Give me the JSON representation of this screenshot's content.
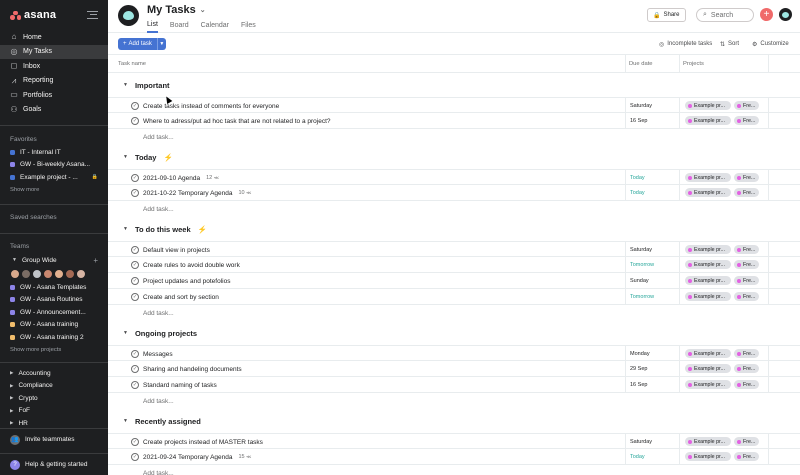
{
  "sidebar": {
    "logo_text": "asana",
    "nav": [
      {
        "label": "Home",
        "icon": "home-icon"
      },
      {
        "label": "My Tasks",
        "icon": "check-circle-icon",
        "active": true
      },
      {
        "label": "Inbox",
        "icon": "bell-icon"
      },
      {
        "label": "Reporting",
        "icon": "chart-line-icon"
      },
      {
        "label": "Portfolios",
        "icon": "folder-icon"
      },
      {
        "label": "Goals",
        "icon": "person-icon"
      }
    ],
    "favorites_heading": "Favorites",
    "favorites": [
      {
        "label": "IT - Internal IT",
        "color": "#4573d2"
      },
      {
        "label": "GW - Bi-weekly Asana...",
        "color": "#8d84e8"
      },
      {
        "label": "Example project - ...",
        "color": "#4573d2",
        "locked": true
      }
    ],
    "favorites_show_more": "Show more",
    "saved_searches_heading": "Saved searches",
    "teams_heading": "Teams",
    "team_name": "Group Wide",
    "team_projects": [
      {
        "label": "GW - Asana Templates",
        "color": "#8d84e8"
      },
      {
        "label": "GW - Asana Routines",
        "color": "#8d84e8"
      },
      {
        "label": "GW - Announcement...",
        "color": "#8d84e8"
      },
      {
        "label": "GW - Asana training",
        "color": "#f1bd6c"
      },
      {
        "label": "GW - Asana training 2",
        "color": "#f1bd6c"
      }
    ],
    "team_show_more": "Show more projects",
    "other_teams": [
      "Accounting",
      "Compliance",
      "Crypto",
      "FoF",
      "HR"
    ],
    "invite_label": "Invite teammates",
    "help_label": "Help & getting started"
  },
  "header": {
    "title": "My Tasks",
    "tabs": [
      "List",
      "Board",
      "Calendar",
      "Files"
    ],
    "share_label": "Share",
    "search_placeholder": "Search"
  },
  "toolbar": {
    "add_task_label": "Add task",
    "incomplete_label": "Incomplete tasks",
    "sort_label": "Sort",
    "customize_label": "Customize"
  },
  "table": {
    "columns": [
      "Task name",
      "Due date",
      "Projects"
    ],
    "add_task_text": "Add task...",
    "tag_project": "Example pr...",
    "tag_second": "Fre...",
    "sections": [
      {
        "name": "Important",
        "emoji": "",
        "tasks": [
          {
            "name": "Create tasks instead of comments for everyone",
            "due": "Saturday",
            "due_color": "normal",
            "sub": ""
          },
          {
            "name": "Where to adress/put ad hoc task that are not related to a project?",
            "due": "16 Sep",
            "due_color": "normal",
            "sub": ""
          }
        ]
      },
      {
        "name": "Today",
        "emoji": "⚡",
        "tasks": [
          {
            "name": "2021-09-10 Agenda",
            "due": "Today",
            "due_color": "green",
            "sub": "12 ⪻"
          },
          {
            "name": "2021-10-22 Temporary Agenda",
            "due": "Today",
            "due_color": "green",
            "sub": "10 ⪻"
          }
        ]
      },
      {
        "name": "To do this week",
        "emoji": "⚡",
        "tasks": [
          {
            "name": "Default view in projects",
            "due": "Saturday",
            "due_color": "normal",
            "sub": ""
          },
          {
            "name": "Create rules to avoid double work",
            "due": "Tomorrow",
            "due_color": "green",
            "sub": ""
          },
          {
            "name": "Project updates and potefolios",
            "due": "Sunday",
            "due_color": "normal",
            "sub": ""
          },
          {
            "name": "Create and sort by section",
            "due": "Tomorrow",
            "due_color": "green",
            "sub": ""
          }
        ]
      },
      {
        "name": "Ongoing projects",
        "emoji": "",
        "tasks": [
          {
            "name": "Messages",
            "due": "Monday",
            "due_color": "normal",
            "sub": ""
          },
          {
            "name": "Sharing and handeling documents",
            "due": "29 Sep",
            "due_color": "normal",
            "sub": ""
          },
          {
            "name": "Standard naming of tasks",
            "due": "16 Sep",
            "due_color": "normal",
            "sub": ""
          }
        ]
      },
      {
        "name": "Recently assigned",
        "emoji": "",
        "tasks": [
          {
            "name": "Create projects instead of MASTER tasks",
            "due": "Saturday",
            "due_color": "normal",
            "sub": ""
          },
          {
            "name": "2021-09-24 Temporary Agenda",
            "due": "Today",
            "due_color": "green",
            "sub": "15 ⪻"
          }
        ]
      }
    ]
  },
  "colors": {
    "accent": "#4573d2",
    "brand": "#f06a6a",
    "green": "#26a69a",
    "tag_dot_1": "#e362e3",
    "tag_dot_2": "#f06a6a"
  }
}
